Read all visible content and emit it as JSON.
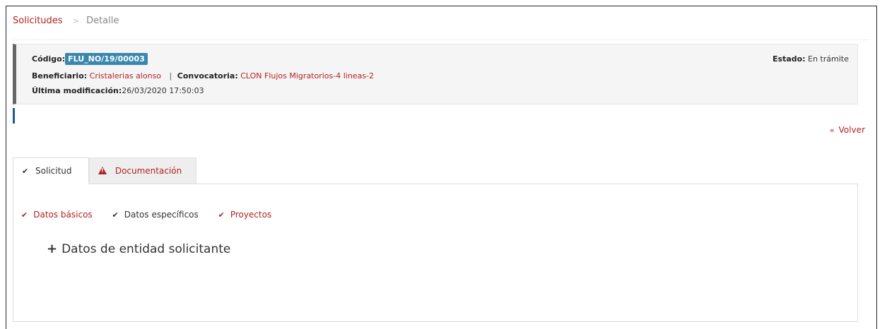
{
  "breadcrumb": {
    "link": "Solicitudes",
    "separator": ">",
    "current": "Detalle"
  },
  "summary": {
    "codigo_label": "Código:",
    "codigo_value": "FLU_NO/19/00003",
    "beneficiario_label": "Beneficiario:",
    "beneficiario_value": "Cristalerias alonso",
    "pipe": "|",
    "convocatoria_label": "Convocatoria:",
    "convocatoria_value": "CLON Flujos Migratorios-4 lineas-2",
    "modificacion_label": "Última modificación:",
    "modificacion_value": "26/03/2020 17:50:03",
    "estado_label": "Estado:",
    "estado_value": "En trámite"
  },
  "volver": {
    "icon": "«",
    "label": "Volver"
  },
  "tabs": [
    {
      "label": "Solicitud",
      "icon": "check-icon",
      "active": true
    },
    {
      "label": "Documentación",
      "icon": "warning-icon",
      "active": false
    }
  ],
  "subnav": [
    {
      "label": "Datos básicos",
      "status": "done"
    },
    {
      "label": "Datos específicos",
      "status": "current"
    },
    {
      "label": "Proyectos",
      "status": "done"
    }
  ],
  "section": {
    "icon": "+",
    "title": "Datos de entidad solicitante"
  },
  "colors": {
    "accent_red": "#b22222",
    "badge_blue": "#3a87ad",
    "accent_bar": "#1f5a96"
  }
}
